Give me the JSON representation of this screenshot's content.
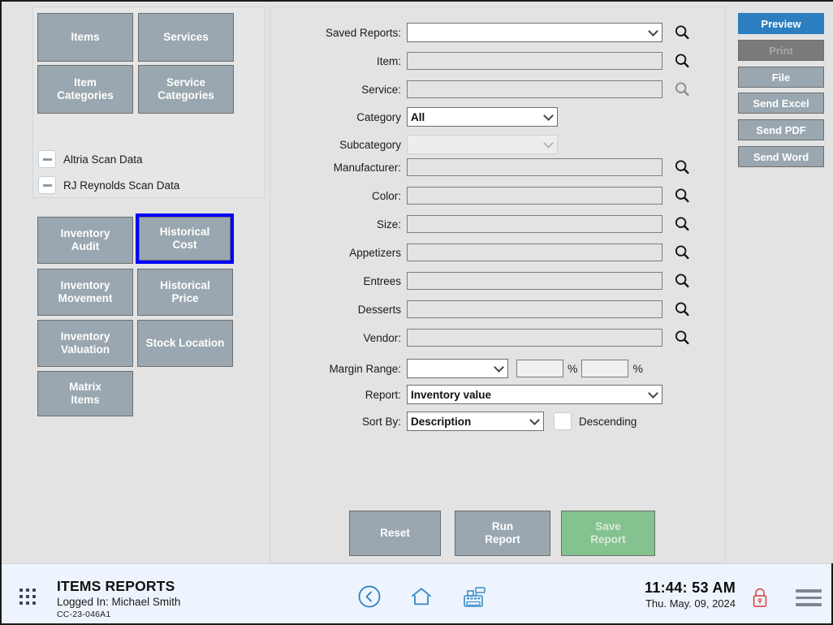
{
  "left": {
    "top_buttons": [
      {
        "label": "Items",
        "name": "items"
      },
      {
        "label": "Services",
        "name": "services"
      },
      {
        "label": "Item\nCategories",
        "name": "item-categories"
      },
      {
        "label": "Service\nCategories",
        "name": "service-categories"
      }
    ],
    "scan_data": [
      {
        "label": "Altria Scan Data",
        "state": "indeterminate"
      },
      {
        "label": "RJ Reynolds Scan Data",
        "state": "indeterminate"
      }
    ],
    "report_buttons": [
      {
        "label": "Inventory\nAudit",
        "name": "inventory-audit",
        "selected": false
      },
      {
        "label": "Historical\nCost",
        "name": "historical-cost",
        "selected": true
      },
      {
        "label": "Inventory\nMovement",
        "name": "inventory-movement",
        "selected": false
      },
      {
        "label": "Historical\nPrice",
        "name": "historical-price",
        "selected": false
      },
      {
        "label": "Inventory\nValuation",
        "name": "inventory-valuation",
        "selected": false
      },
      {
        "label": "Stock Location",
        "name": "stock-location",
        "selected": false
      },
      {
        "label": "Matrix\nItems",
        "name": "matrix-items",
        "selected": false
      }
    ]
  },
  "form": {
    "rows": [
      {
        "label": "Saved Reports:",
        "type": "select",
        "value": "",
        "disabled": false,
        "magnifier": "enabled"
      },
      {
        "label": "Item:",
        "type": "text",
        "value": "",
        "magnifier": "enabled"
      },
      {
        "label": "Service:",
        "type": "text",
        "value": "",
        "magnifier": "disabled"
      },
      {
        "label": "Category",
        "type": "select",
        "value": "All",
        "disabled": false,
        "magnifier": "none"
      },
      {
        "label": "Subcategory",
        "type": "select",
        "value": "",
        "disabled": true,
        "magnifier": "none"
      },
      {
        "label": "Manufacturer:",
        "type": "text",
        "value": "",
        "magnifier": "enabled"
      },
      {
        "label": "Color:",
        "type": "text",
        "value": "",
        "magnifier": "enabled"
      },
      {
        "label": "Size:",
        "type": "text",
        "value": "",
        "magnifier": "enabled"
      },
      {
        "label": "Appetizers",
        "type": "text",
        "value": "",
        "magnifier": "enabled"
      },
      {
        "label": "Entrees",
        "type": "text",
        "value": "",
        "magnifier": "enabled"
      },
      {
        "label": "Desserts",
        "type": "text",
        "value": "",
        "magnifier": "enabled"
      },
      {
        "label": "Vendor:",
        "type": "text",
        "value": "",
        "magnifier": "enabled"
      }
    ],
    "margin_range": {
      "label": "Margin Range:",
      "operator_value": "",
      "from_value": "",
      "to_value": "",
      "pct_symbol_1": "%",
      "pct_symbol_2": "%"
    },
    "report": {
      "label": "Report:",
      "value": "Inventory value"
    },
    "sort_by": {
      "label": "Sort By:",
      "value": "Description",
      "descending_label": "Descending",
      "descending_checked": false
    }
  },
  "actions": [
    {
      "label": "Reset",
      "name": "reset",
      "style": "gray"
    },
    {
      "label": "Run\nReport",
      "name": "run-report",
      "style": "gray"
    },
    {
      "label": "Save\nReport",
      "name": "save-report",
      "style": "green"
    }
  ],
  "output_buttons": [
    {
      "label": "Preview",
      "name": "preview",
      "state": "active"
    },
    {
      "label": "Print",
      "name": "print",
      "state": "disabled"
    },
    {
      "label": "File",
      "name": "file",
      "state": "normal"
    },
    {
      "label": "Send Excel",
      "name": "send-excel",
      "state": "normal"
    },
    {
      "label": "Send PDF",
      "name": "send-pdf",
      "state": "normal"
    },
    {
      "label": "Send Word",
      "name": "send-word",
      "state": "normal"
    }
  ],
  "statusbar": {
    "title": "ITEMS REPORTS",
    "logged_in": "Logged In:  Michael Smith",
    "code": "CC-23-046A1",
    "time": "11:44: 53 AM",
    "date": "Thu. May. 09, 2024",
    "icons": [
      "back-icon",
      "home-icon",
      "register-icon",
      "lock-icon",
      "menu-icon"
    ]
  },
  "colors": {
    "accent_blue": "#2b7fc0",
    "button_gray": "#9aa7b0",
    "save_green": "#84c28f",
    "selection_blue": "#0000ff",
    "lock_red": "#d9534f",
    "statusbar_bg": "#eef4fd"
  }
}
